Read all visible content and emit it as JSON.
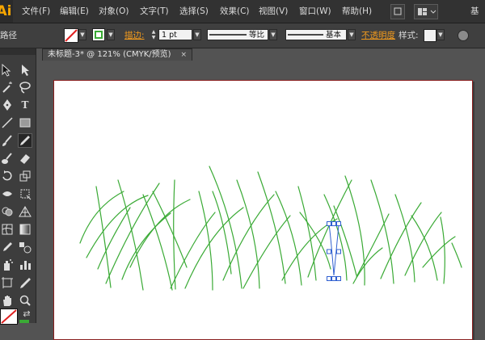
{
  "app": {
    "logo": "Ai"
  },
  "menubar": {
    "items": [
      "文件(F)",
      "编辑(E)",
      "对象(O)",
      "文字(T)",
      "选择(S)",
      "效果(C)",
      "视图(V)",
      "窗口(W)",
      "帮助(H)"
    ],
    "workspace": "基本"
  },
  "controlbar": {
    "selection_label": "路径",
    "stroke_label": "描边:",
    "stroke_weight": "1 pt",
    "profile": "等比",
    "brush": "基本",
    "opacity_label": "不透明度",
    "style_label": "样式:"
  },
  "document": {
    "tab_title": "未标题-3* @ 121% (CMYK/预览)",
    "close_glyph": "×"
  },
  "tools": {
    "type_glyph": "T"
  },
  "colors": {
    "stroke_green": "#3aaa35",
    "selection_blue": "#2f5fd0",
    "artboard_border": "#8a1e1e",
    "accent_orange": "#f39b1d"
  }
}
